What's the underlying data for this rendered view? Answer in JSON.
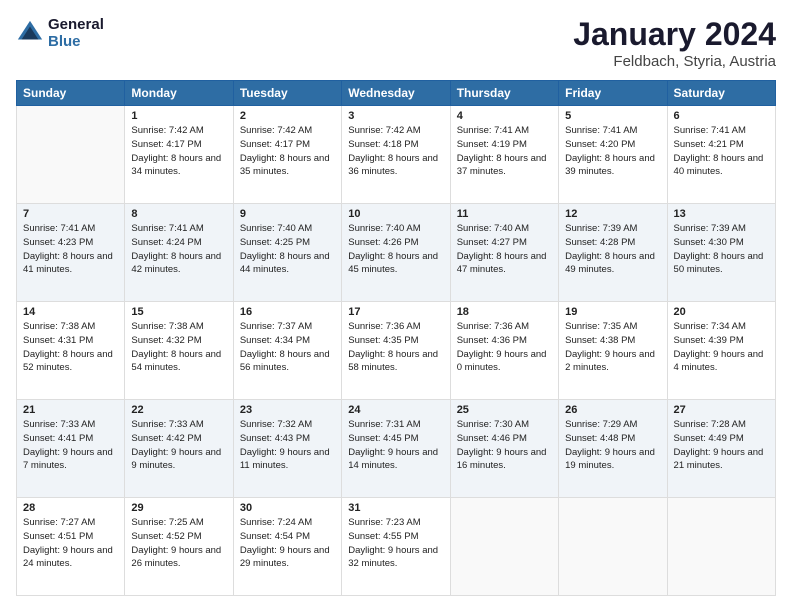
{
  "header": {
    "logo_line1": "General",
    "logo_line2": "Blue",
    "month": "January 2024",
    "location": "Feldbach, Styria, Austria"
  },
  "days_of_week": [
    "Sunday",
    "Monday",
    "Tuesday",
    "Wednesday",
    "Thursday",
    "Friday",
    "Saturday"
  ],
  "weeks": [
    [
      {
        "day": "",
        "sunrise": "",
        "sunset": "",
        "daylight": ""
      },
      {
        "day": "1",
        "sunrise": "Sunrise: 7:42 AM",
        "sunset": "Sunset: 4:17 PM",
        "daylight": "Daylight: 8 hours and 34 minutes."
      },
      {
        "day": "2",
        "sunrise": "Sunrise: 7:42 AM",
        "sunset": "Sunset: 4:17 PM",
        "daylight": "Daylight: 8 hours and 35 minutes."
      },
      {
        "day": "3",
        "sunrise": "Sunrise: 7:42 AM",
        "sunset": "Sunset: 4:18 PM",
        "daylight": "Daylight: 8 hours and 36 minutes."
      },
      {
        "day": "4",
        "sunrise": "Sunrise: 7:41 AM",
        "sunset": "Sunset: 4:19 PM",
        "daylight": "Daylight: 8 hours and 37 minutes."
      },
      {
        "day": "5",
        "sunrise": "Sunrise: 7:41 AM",
        "sunset": "Sunset: 4:20 PM",
        "daylight": "Daylight: 8 hours and 39 minutes."
      },
      {
        "day": "6",
        "sunrise": "Sunrise: 7:41 AM",
        "sunset": "Sunset: 4:21 PM",
        "daylight": "Daylight: 8 hours and 40 minutes."
      }
    ],
    [
      {
        "day": "7",
        "sunrise": "Sunrise: 7:41 AM",
        "sunset": "Sunset: 4:23 PM",
        "daylight": "Daylight: 8 hours and 41 minutes."
      },
      {
        "day": "8",
        "sunrise": "Sunrise: 7:41 AM",
        "sunset": "Sunset: 4:24 PM",
        "daylight": "Daylight: 8 hours and 42 minutes."
      },
      {
        "day": "9",
        "sunrise": "Sunrise: 7:40 AM",
        "sunset": "Sunset: 4:25 PM",
        "daylight": "Daylight: 8 hours and 44 minutes."
      },
      {
        "day": "10",
        "sunrise": "Sunrise: 7:40 AM",
        "sunset": "Sunset: 4:26 PM",
        "daylight": "Daylight: 8 hours and 45 minutes."
      },
      {
        "day": "11",
        "sunrise": "Sunrise: 7:40 AM",
        "sunset": "Sunset: 4:27 PM",
        "daylight": "Daylight: 8 hours and 47 minutes."
      },
      {
        "day": "12",
        "sunrise": "Sunrise: 7:39 AM",
        "sunset": "Sunset: 4:28 PM",
        "daylight": "Daylight: 8 hours and 49 minutes."
      },
      {
        "day": "13",
        "sunrise": "Sunrise: 7:39 AM",
        "sunset": "Sunset: 4:30 PM",
        "daylight": "Daylight: 8 hours and 50 minutes."
      }
    ],
    [
      {
        "day": "14",
        "sunrise": "Sunrise: 7:38 AM",
        "sunset": "Sunset: 4:31 PM",
        "daylight": "Daylight: 8 hours and 52 minutes."
      },
      {
        "day": "15",
        "sunrise": "Sunrise: 7:38 AM",
        "sunset": "Sunset: 4:32 PM",
        "daylight": "Daylight: 8 hours and 54 minutes."
      },
      {
        "day": "16",
        "sunrise": "Sunrise: 7:37 AM",
        "sunset": "Sunset: 4:34 PM",
        "daylight": "Daylight: 8 hours and 56 minutes."
      },
      {
        "day": "17",
        "sunrise": "Sunrise: 7:36 AM",
        "sunset": "Sunset: 4:35 PM",
        "daylight": "Daylight: 8 hours and 58 minutes."
      },
      {
        "day": "18",
        "sunrise": "Sunrise: 7:36 AM",
        "sunset": "Sunset: 4:36 PM",
        "daylight": "Daylight: 9 hours and 0 minutes."
      },
      {
        "day": "19",
        "sunrise": "Sunrise: 7:35 AM",
        "sunset": "Sunset: 4:38 PM",
        "daylight": "Daylight: 9 hours and 2 minutes."
      },
      {
        "day": "20",
        "sunrise": "Sunrise: 7:34 AM",
        "sunset": "Sunset: 4:39 PM",
        "daylight": "Daylight: 9 hours and 4 minutes."
      }
    ],
    [
      {
        "day": "21",
        "sunrise": "Sunrise: 7:33 AM",
        "sunset": "Sunset: 4:41 PM",
        "daylight": "Daylight: 9 hours and 7 minutes."
      },
      {
        "day": "22",
        "sunrise": "Sunrise: 7:33 AM",
        "sunset": "Sunset: 4:42 PM",
        "daylight": "Daylight: 9 hours and 9 minutes."
      },
      {
        "day": "23",
        "sunrise": "Sunrise: 7:32 AM",
        "sunset": "Sunset: 4:43 PM",
        "daylight": "Daylight: 9 hours and 11 minutes."
      },
      {
        "day": "24",
        "sunrise": "Sunrise: 7:31 AM",
        "sunset": "Sunset: 4:45 PM",
        "daylight": "Daylight: 9 hours and 14 minutes."
      },
      {
        "day": "25",
        "sunrise": "Sunrise: 7:30 AM",
        "sunset": "Sunset: 4:46 PM",
        "daylight": "Daylight: 9 hours and 16 minutes."
      },
      {
        "day": "26",
        "sunrise": "Sunrise: 7:29 AM",
        "sunset": "Sunset: 4:48 PM",
        "daylight": "Daylight: 9 hours and 19 minutes."
      },
      {
        "day": "27",
        "sunrise": "Sunrise: 7:28 AM",
        "sunset": "Sunset: 4:49 PM",
        "daylight": "Daylight: 9 hours and 21 minutes."
      }
    ],
    [
      {
        "day": "28",
        "sunrise": "Sunrise: 7:27 AM",
        "sunset": "Sunset: 4:51 PM",
        "daylight": "Daylight: 9 hours and 24 minutes."
      },
      {
        "day": "29",
        "sunrise": "Sunrise: 7:25 AM",
        "sunset": "Sunset: 4:52 PM",
        "daylight": "Daylight: 9 hours and 26 minutes."
      },
      {
        "day": "30",
        "sunrise": "Sunrise: 7:24 AM",
        "sunset": "Sunset: 4:54 PM",
        "daylight": "Daylight: 9 hours and 29 minutes."
      },
      {
        "day": "31",
        "sunrise": "Sunrise: 7:23 AM",
        "sunset": "Sunset: 4:55 PM",
        "daylight": "Daylight: 9 hours and 32 minutes."
      },
      {
        "day": "",
        "sunrise": "",
        "sunset": "",
        "daylight": ""
      },
      {
        "day": "",
        "sunrise": "",
        "sunset": "",
        "daylight": ""
      },
      {
        "day": "",
        "sunrise": "",
        "sunset": "",
        "daylight": ""
      }
    ]
  ]
}
